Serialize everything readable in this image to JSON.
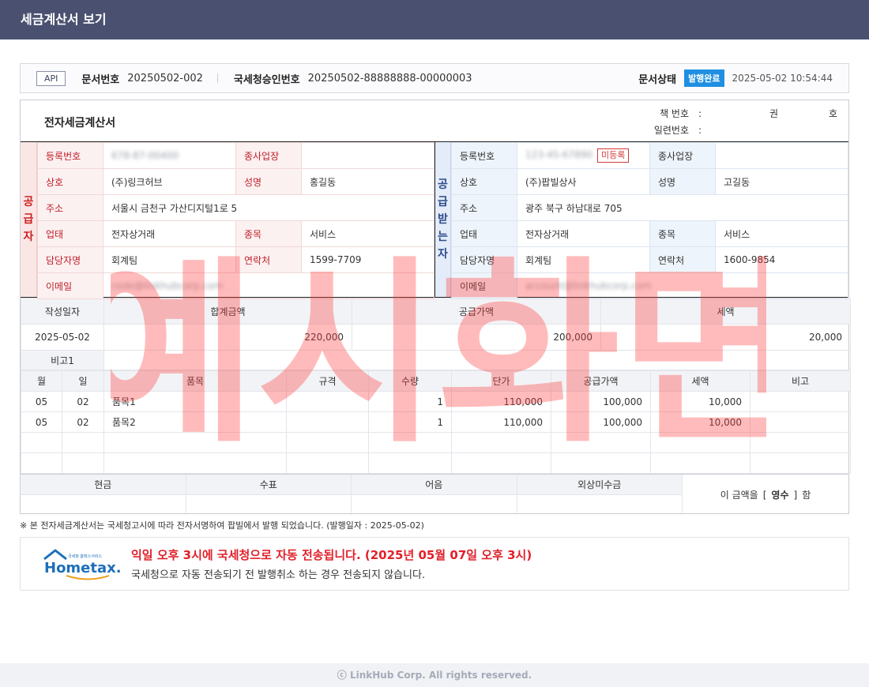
{
  "window": {
    "title": "세금계산서 보기"
  },
  "doc_info": {
    "api_label": "API",
    "doc_no_label": "문서번호",
    "doc_no": "20250502-002",
    "nts_label": "국세청승인번호",
    "nts_no": "20250502-88888888-00000003",
    "status_label": "문서상태",
    "status": "발행완료",
    "timestamp": "2025-05-02 10:54:44"
  },
  "invoice": {
    "title": "전자세금계산서",
    "book_label": "책 번호",
    "colon": ":",
    "gwon": "권",
    "ho": "호",
    "serial_label": "일련번호"
  },
  "supplier": {
    "side": "공급자",
    "reg_label": "등록번호",
    "reg": "678-87-00400",
    "branch_label": "종사업장",
    "branch": "",
    "name_label": "상호",
    "name": "(주)링크허브",
    "ceo_label": "성명",
    "ceo": "홍길동",
    "addr_label": "주소",
    "addr": "서울시 금천구 가산디지털1로 5",
    "biz_label": "업태",
    "biz": "전자상거래",
    "type_label": "종목",
    "type": "서비스",
    "contact_label": "담당자명",
    "contact": "회계팀",
    "tel_label": "연락처",
    "tel": "1599-7709",
    "email_label": "이메일",
    "email": "code@linkhubcorp.com"
  },
  "receiver": {
    "side": "공급받는자",
    "reg_label": "등록번호",
    "reg": "123-45-67890",
    "unregistered": "미등록",
    "branch_label": "종사업장",
    "branch": "",
    "name_label": "상호",
    "name": "(주)팝빌상사",
    "ceo_label": "성명",
    "ceo": "고길동",
    "addr_label": "주소",
    "addr": "광주 북구 하남대로 705",
    "biz_label": "업태",
    "biz": "전자상거래",
    "type_label": "종목",
    "type": "서비스",
    "contact_label": "담당자명",
    "contact": "회계팀",
    "tel_label": "연락처",
    "tel": "1600-9854",
    "email_label": "이메일",
    "email": "account@linkhubcorp.com"
  },
  "summary": {
    "date_label": "작성일자",
    "date": "2025-05-02",
    "total_label": "합계금액",
    "total": "220,000",
    "supply_label": "공급가액",
    "supply": "200,000",
    "tax_label": "세액",
    "tax": "20,000",
    "memo_label": "비고1",
    "memo": ""
  },
  "items": {
    "headers": [
      "월",
      "일",
      "품목",
      "규격",
      "수량",
      "단가",
      "공급가액",
      "세액",
      "비고"
    ],
    "rows": [
      {
        "month": "05",
        "day": "02",
        "name": "품목1",
        "spec": "",
        "qty": "1",
        "price": "110,000",
        "supply": "100,000",
        "tax": "10,000",
        "note": ""
      },
      {
        "month": "05",
        "day": "02",
        "name": "품목2",
        "spec": "",
        "qty": "1",
        "price": "110,000",
        "supply": "100,000",
        "tax": "10,000",
        "note": ""
      }
    ]
  },
  "payment": {
    "cash": "현금",
    "check": "수표",
    "note": "어음",
    "credit": "외상미수금",
    "receipt_pre": "이 금액을",
    "bracket_open": "[",
    "receipt_kind": "영수",
    "bracket_close": "]",
    "receipt_post": "함"
  },
  "notice": "※ 본 전자세금계산서는 국세청고시에 따라 전자서명하여 팝빌에서 발행 되었습니다. (발행일자 : 2025-05-02)",
  "hometax": {
    "logo_text": "Hometax.",
    "logo_sub": "국세청 홈택스서비스",
    "msg1": "익일 오후 3시에 국세청으로 자동 전송됩니다. (2025년 05월 07일 오후 3시)",
    "msg2": "국세청으로 자동 전송되기 전 발행취소 하는 경우 전송되지 않습니다."
  },
  "watermark": "예시화면",
  "footer": "ⓒ LinkHub Corp. All rights reserved.",
  "colors": {
    "header": "#4a5170",
    "supplier": "#c0202a",
    "receiver": "#2d4b8c",
    "status": "#1e8fe1"
  }
}
